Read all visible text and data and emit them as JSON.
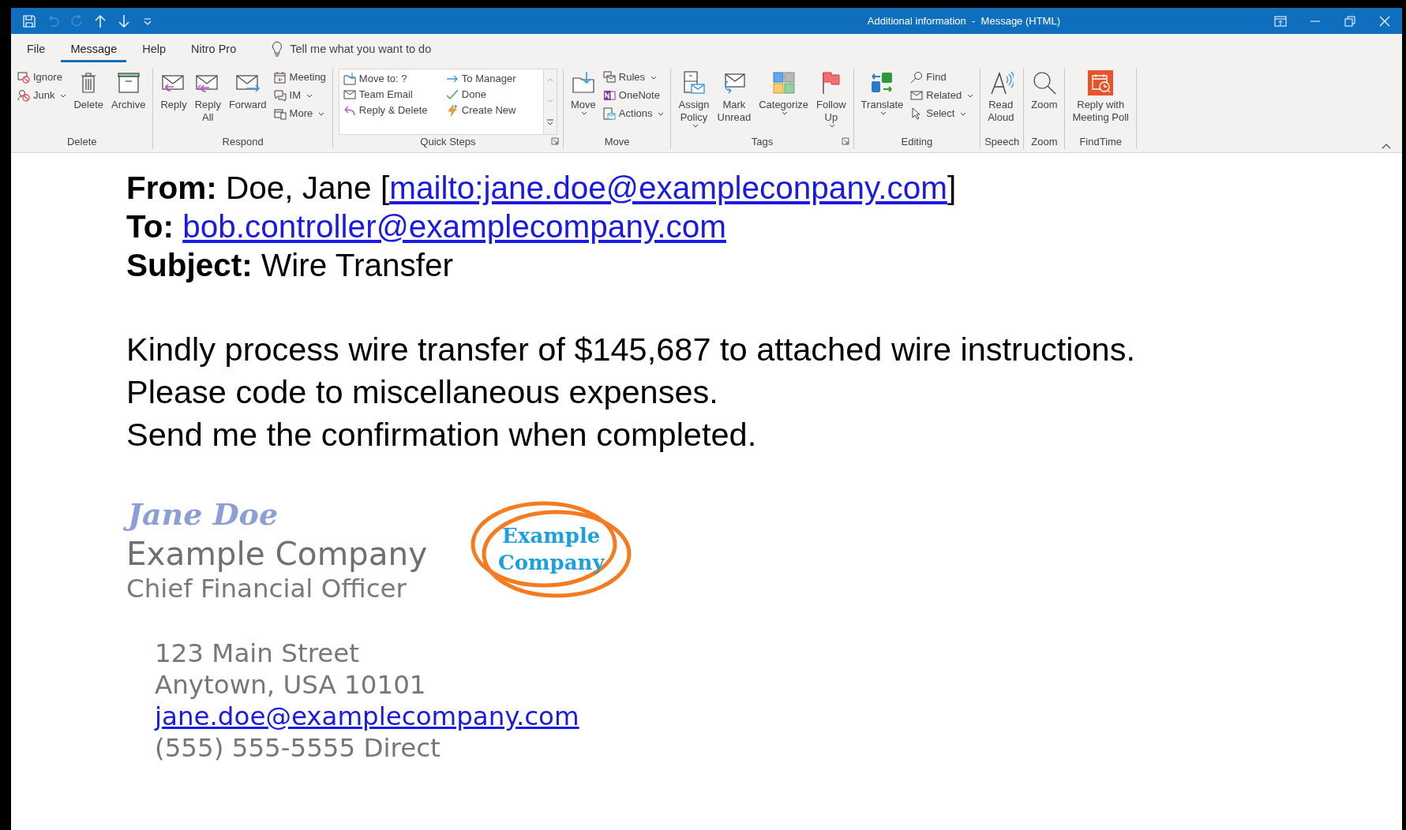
{
  "window": {
    "title": "Additional information  -  Message (HTML)"
  },
  "quick_access": [
    {
      "kind": "save",
      "disabled": false
    },
    {
      "kind": "undo",
      "disabled": true
    },
    {
      "kind": "redo",
      "disabled": true
    },
    {
      "kind": "up",
      "disabled": false
    },
    {
      "kind": "down",
      "disabled": false
    },
    {
      "kind": "customize",
      "disabled": false
    }
  ],
  "tabs": [
    {
      "label": "File",
      "selected": false
    },
    {
      "label": "Message",
      "selected": true
    },
    {
      "label": "Help",
      "selected": false
    },
    {
      "label": "Nitro Pro",
      "selected": false
    }
  ],
  "tell_me": {
    "placeholder": "Tell me what you want to do"
  },
  "ribbon": {
    "groups": [
      {
        "name": "Delete",
        "launcher": false,
        "items": [
          {
            "kind": "small",
            "label": "Ignore",
            "dropdown": false
          },
          {
            "kind": "small",
            "label": "Junk",
            "dropdown": true
          },
          {
            "kind": "large",
            "label": "Delete",
            "dropdown": false
          },
          {
            "kind": "large",
            "label": "Archive",
            "dropdown": false
          }
        ]
      },
      {
        "name": "Respond",
        "launcher": false,
        "items": [
          {
            "kind": "large",
            "label": "Reply",
            "dropdown": false
          },
          {
            "kind": "large",
            "label": "Reply\nAll",
            "dropdown": false
          },
          {
            "kind": "large",
            "label": "Forward",
            "dropdown": false
          },
          {
            "kind": "small",
            "label": "Meeting",
            "dropdown": false
          },
          {
            "kind": "small",
            "label": "IM",
            "dropdown": true
          },
          {
            "kind": "small",
            "label": "More",
            "dropdown": true
          }
        ]
      },
      {
        "name": "Quick Steps",
        "launcher": true,
        "items": [
          {
            "kind": "gallery",
            "label": "Move to: ?"
          },
          {
            "kind": "gallery",
            "label": "To Manager"
          },
          {
            "kind": "gallery",
            "label": "Team Email"
          },
          {
            "kind": "gallery",
            "label": "Done"
          },
          {
            "kind": "gallery",
            "label": "Reply & Delete"
          },
          {
            "kind": "gallery",
            "label": "Create New"
          }
        ]
      },
      {
        "name": "Move",
        "launcher": false,
        "items": [
          {
            "kind": "large",
            "label": "Move",
            "dropdown": true
          },
          {
            "kind": "small",
            "label": "Rules",
            "dropdown": true
          },
          {
            "kind": "small",
            "label": "OneNote",
            "dropdown": false
          },
          {
            "kind": "small",
            "label": "Actions",
            "dropdown": true
          }
        ]
      },
      {
        "name": "Tags",
        "launcher": true,
        "items": [
          {
            "kind": "large",
            "label": "Assign\nPolicy",
            "dropdown": true
          },
          {
            "kind": "large",
            "label": "Mark\nUnread",
            "dropdown": false
          },
          {
            "kind": "large",
            "label": "Categorize",
            "dropdown": true
          },
          {
            "kind": "large",
            "label": "Follow\nUp",
            "dropdown": true
          }
        ]
      },
      {
        "name": "Editing",
        "launcher": false,
        "items": [
          {
            "kind": "large",
            "label": "Translate",
            "dropdown": true
          },
          {
            "kind": "small",
            "label": "Find",
            "dropdown": false
          },
          {
            "kind": "small",
            "label": "Related",
            "dropdown": true
          },
          {
            "kind": "small",
            "label": "Select",
            "dropdown": true
          }
        ]
      },
      {
        "name": "Speech",
        "launcher": false,
        "items": [
          {
            "kind": "large",
            "label": "Read\nAloud",
            "dropdown": false
          }
        ]
      },
      {
        "name": "Zoom",
        "launcher": false,
        "items": [
          {
            "kind": "large",
            "label": "Zoom",
            "dropdown": false
          }
        ]
      },
      {
        "name": "FindTime",
        "launcher": false,
        "items": [
          {
            "kind": "large",
            "label": "Reply with\nMeeting Poll",
            "dropdown": false
          }
        ]
      }
    ]
  },
  "message": {
    "headers": [
      {
        "label": "From:",
        "parts": [
          {
            "kind": "text",
            "text": "Doe, Jane ["
          },
          {
            "kind": "link",
            "text": "mailto:jane.doe@exampleconpany.com"
          },
          {
            "kind": "text",
            "text": "]"
          }
        ]
      },
      {
        "label": "To:",
        "parts": [
          {
            "kind": "link",
            "text": "bob.controller@examplecompany.com"
          }
        ]
      },
      {
        "label": "Subject:",
        "parts": [
          {
            "kind": "text",
            "text": "Wire Transfer"
          }
        ]
      }
    ],
    "body": [
      "Kindly process wire transfer of $145,687 to attached wire instructions.",
      "Please code to miscellaneous expenses.",
      "Send me the confirmation when completed."
    ],
    "signature": {
      "name": "Jane Doe",
      "company": "Example Company",
      "title": "Chief Financial Officer",
      "logo": "Example\nCompany",
      "contact": [
        {
          "kind": "text",
          "text": "123 Main Street"
        },
        {
          "kind": "text",
          "text": "Anytown, USA 10101"
        },
        {
          "kind": "link",
          "text": "jane.doe@examplecompany.com"
        },
        {
          "kind": "text",
          "text": "(555) 555-5555 Direct"
        }
      ]
    }
  }
}
